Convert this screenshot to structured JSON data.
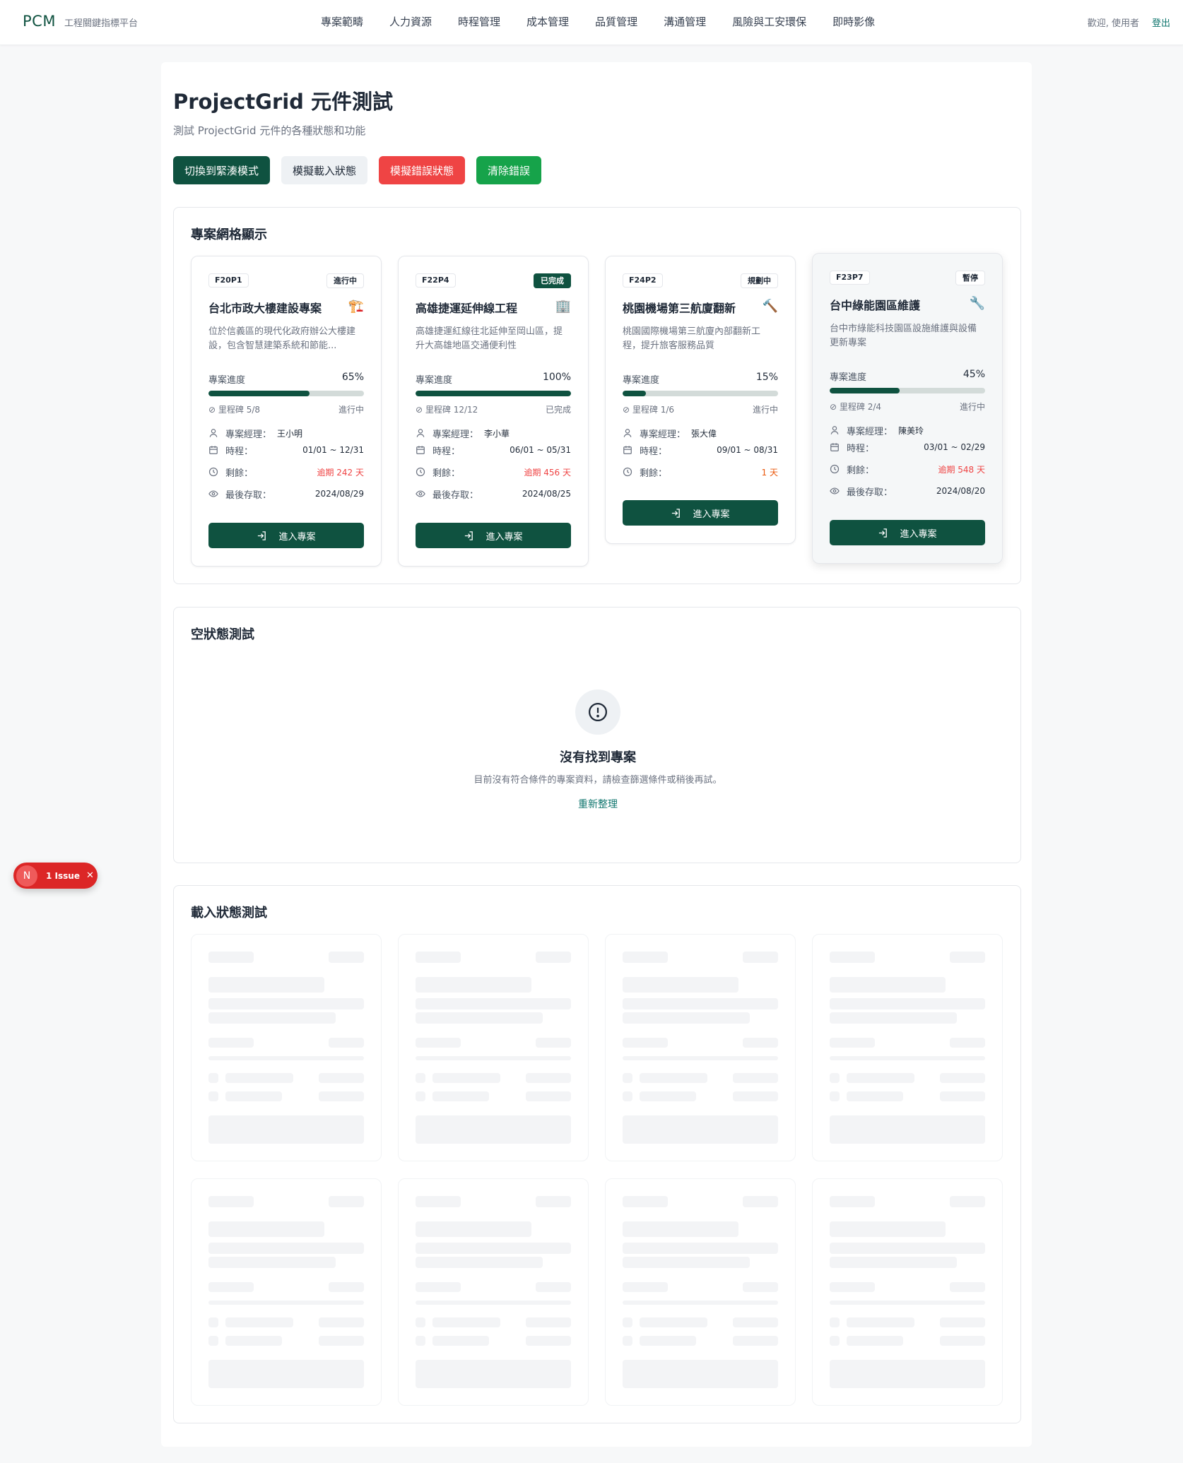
{
  "header": {
    "logo": "PCM",
    "subtitle": "工程關鍵指標平台",
    "nav": [
      "專案範疇",
      "人力資源",
      "時程管理",
      "成本管理",
      "品質管理",
      "溝通管理",
      "風險與工安環保",
      "即時影像"
    ],
    "welcome": "歡迎, 使用者",
    "logout": "登出"
  },
  "page": {
    "title": "ProjectGrid 元件測試",
    "description": "測試 ProjectGrid 元件的各種狀態和功能",
    "buttons": {
      "compact": "切換到緊湊模式",
      "loading": "模擬載入狀態",
      "error": "模擬錯誤狀態",
      "clear": "清除錯誤"
    }
  },
  "grid_section": {
    "title": "專案網格顯示",
    "labels": {
      "progress": "專案進度",
      "manager": "專案經理：",
      "schedule": "時程：",
      "remaining": "剩餘：",
      "last_access": "最後存取：",
      "enter": "進入專案"
    },
    "projects": [
      {
        "code": "F20P1",
        "status": "進行中",
        "name": "台北市政大樓建設專案",
        "emoji": "🏗️",
        "description": "位於信義區的現代化政府辦公大樓建設，包含智慧建築系統和節能...",
        "progress_text": "65%",
        "progress": 65,
        "milestone": "里程碑 5/8",
        "milestone_status": "進行中",
        "manager": "王小明",
        "schedule": "01/01 ~ 12/31",
        "remaining": "逾期 242 天",
        "last_access": "2024/08/29"
      },
      {
        "code": "F22P4",
        "status": "已完成",
        "name": "高雄捷運延伸線工程",
        "emoji": "🏢",
        "description": "高雄捷運紅線往北延伸至岡山區，提升大高雄地區交通便利性",
        "progress_text": "100%",
        "progress": 100,
        "milestone": "里程碑 12/12",
        "milestone_status": "已完成",
        "manager": "李小華",
        "schedule": "06/01 ~ 05/31",
        "remaining": "逾期 456 天",
        "last_access": "2024/08/25"
      },
      {
        "code": "F24P2",
        "status": "規劃中",
        "name": "桃園機場第三航廈翻新",
        "emoji": "🔨",
        "description": "桃園國際機場第三航廈內部翻新工程，提升旅客服務品質",
        "progress_text": "15%",
        "progress": 15,
        "milestone": "里程碑 1/6",
        "milestone_status": "進行中",
        "manager": "張大偉",
        "schedule": "09/01 ~ 08/31",
        "remaining": "1 天",
        "last_access": ""
      },
      {
        "code": "F23P7",
        "status": "暫停",
        "name": "台中綠能園區維護",
        "emoji": "🔧",
        "description": "台中市綠能科技園區設施維護與設備更新專案",
        "progress_text": "45%",
        "progress": 45,
        "milestone": "里程碑 2/4",
        "milestone_status": "進行中",
        "manager": "陳美玲",
        "schedule": "03/01 ~ 02/29",
        "remaining": "逾期 548 天",
        "last_access": "2024/08/20"
      }
    ]
  },
  "empty_section": {
    "title": "空狀態測試",
    "heading": "沒有找到專案",
    "description": "目前沒有符合條件的專案資料，請檢查篩選條件或稍後再試。",
    "action": "重新整理"
  },
  "loading_section": {
    "title": "載入狀態測試"
  },
  "issue_badge": {
    "initial": "N",
    "label": "1 Issue",
    "close": "✕"
  },
  "colors": {
    "primary": "#0f5240",
    "danger": "#ef4444",
    "success": "#16a34a",
    "overdue": "#ef4444",
    "warning": "#ea580c"
  }
}
